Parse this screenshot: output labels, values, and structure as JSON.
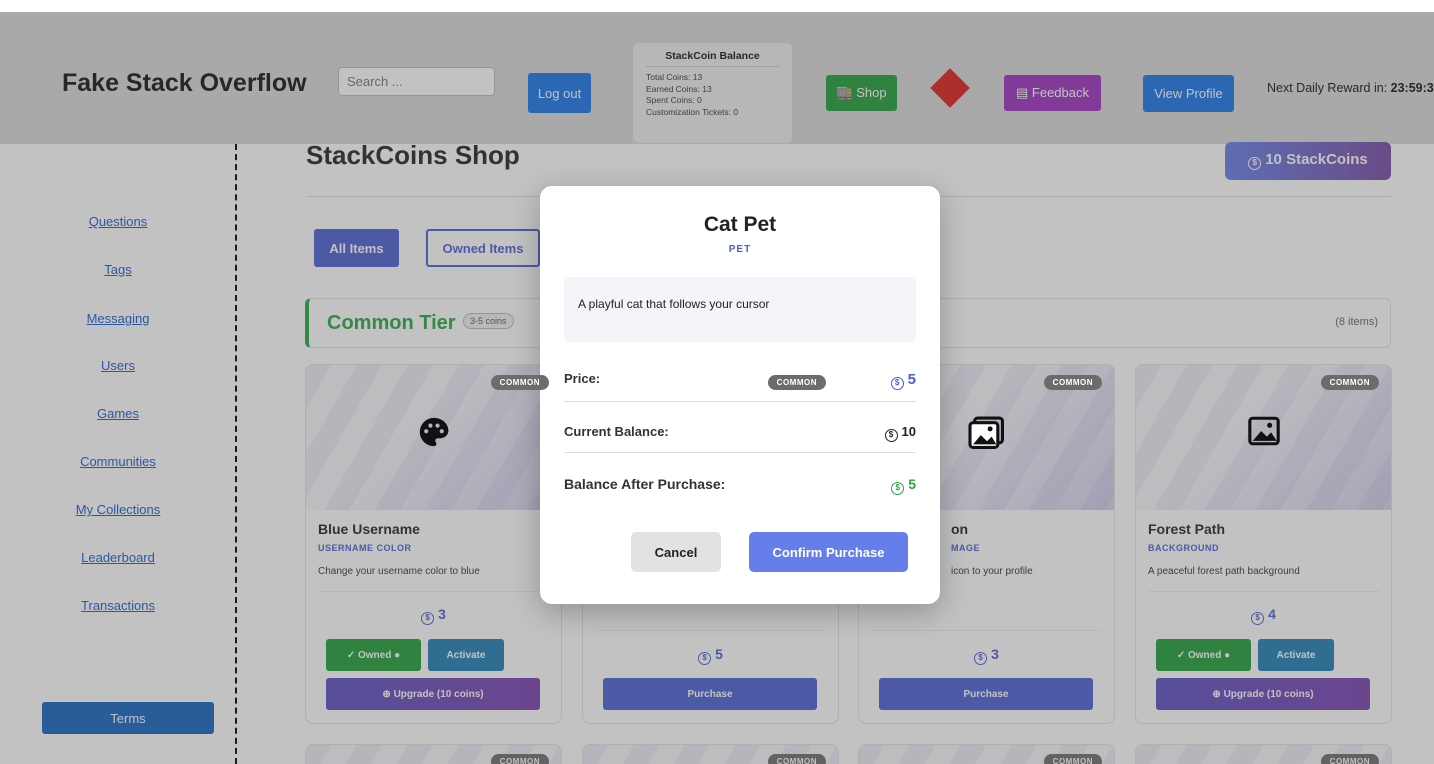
{
  "header": {
    "brand": "Fake Stack Overflow",
    "search_placeholder": "Search ...",
    "logout_label": "Log out",
    "balance": {
      "title": "StackCoin Balance",
      "total": "Total Coins: 13",
      "earned": "Earned Coins: 13",
      "spent": "Spent Coins: 0",
      "tickets": "Customization Tickets: 0"
    },
    "shop_label": "Shop",
    "feedback_label": "Feedback",
    "profile_label": "View Profile",
    "reward_label": "Next Daily Reward in: ",
    "reward_time": "23:59:3"
  },
  "sidebar": {
    "items": [
      {
        "label": "Questions"
      },
      {
        "label": "Tags"
      },
      {
        "label": "Messaging"
      },
      {
        "label": "Users"
      },
      {
        "label": "Games"
      },
      {
        "label": "Communities"
      },
      {
        "label": "My Collections"
      },
      {
        "label": "Leaderboard"
      },
      {
        "label": "Transactions"
      }
    ],
    "terms_label": "Terms"
  },
  "shop": {
    "title": "StackCoins Shop",
    "coins_label": "10 StackCoins",
    "tabs": {
      "all": "All Items",
      "owned": "Owned Items"
    },
    "tier": {
      "name": "Common Tier",
      "range": "3-5 coins",
      "count": "(8 items)"
    },
    "cards": [
      {
        "badge": "COMMON",
        "name": "Blue Username",
        "type": "USERNAME COLOR",
        "desc": "Change your username color to blue",
        "price": "3",
        "owned": "Owned",
        "activate": "Activate",
        "upgrade": "Upgrade (10 coins)"
      },
      {
        "badge": "COMMON",
        "price": "5",
        "purchase": "Purchase"
      },
      {
        "badge": "COMMON",
        "name": "on",
        "type": "MAGE",
        "desc": "icon to your profile",
        "price": "3",
        "purchase": "Purchase"
      },
      {
        "badge": "COMMON",
        "name": "Forest Path",
        "type": "BACKGROUND",
        "desc": "A peaceful forest path background",
        "price": "4",
        "owned": "Owned",
        "activate": "Activate",
        "upgrade": "Upgrade (10 coins)"
      }
    ],
    "next_row_badges": [
      "COMMON",
      "COMMON",
      "COMMON",
      "COMMON"
    ]
  },
  "modal": {
    "title": "Cat Pet",
    "type": "PET",
    "description": "A playful cat that follows your cursor",
    "price_label": "Price:",
    "price_value": "5",
    "balance_label": "Current Balance:",
    "balance_value": "10",
    "after_label": "Balance After Purchase:",
    "after_value": "5",
    "cancel_label": "Cancel",
    "confirm_label": "Confirm Purchase"
  },
  "colors": {
    "primary": "#4a5fd1",
    "success": "#28a745",
    "header_bg": "#d9d9d9",
    "danger_diamond": "#e01b1b"
  },
  "coin_symbol": "$"
}
